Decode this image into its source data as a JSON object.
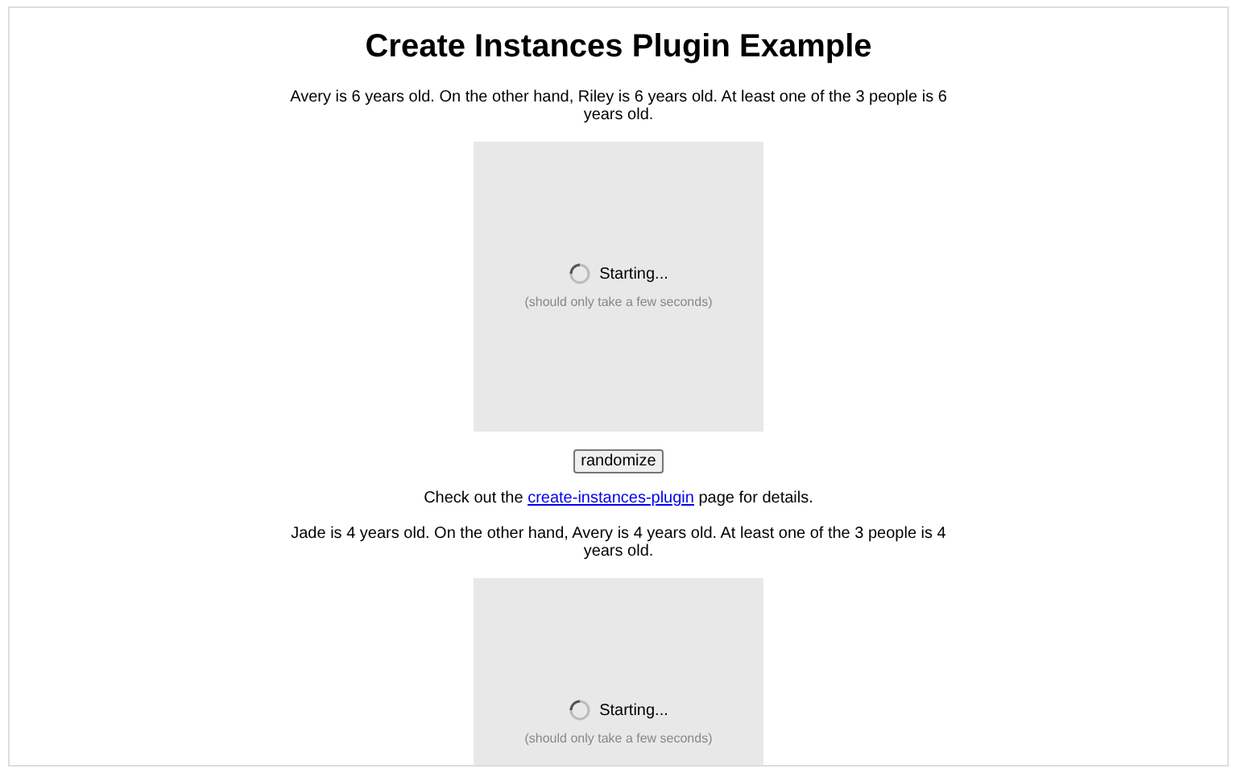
{
  "title": "Create Instances Plugin Example",
  "blocks": [
    {
      "kind": "sentence",
      "text": "Avery is 6 years old. On the other hand, Riley is 6 years old. At least one of the 3 people is 6 years old."
    },
    {
      "kind": "player",
      "status": "Starting...",
      "hint": "(should only take a few seconds)"
    },
    {
      "kind": "button",
      "label": "randomize"
    },
    {
      "kind": "link_line",
      "before": "Check out the",
      "link": "create-instances-plugin",
      "after": "page for details."
    },
    {
      "kind": "sentence",
      "text": "Jade is 4 years old. On the other hand, Avery is 4 years old. At least one of the 3 people is 4 years old."
    },
    {
      "kind": "player",
      "status": "Starting...",
      "hint": "(should only take a few seconds)"
    }
  ]
}
